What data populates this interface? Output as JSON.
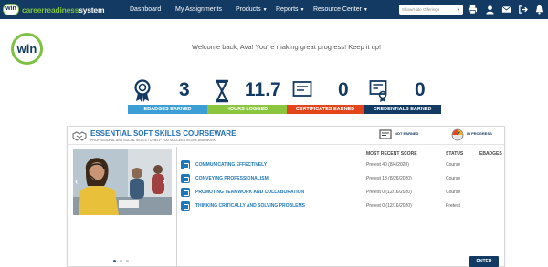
{
  "header": {
    "brand_prefix": "careerreadiness",
    "brand_suffix": "system",
    "badge_text": "win",
    "nav": [
      {
        "label": "Dashboard",
        "has_caret": false
      },
      {
        "label": "My Assignments",
        "has_caret": false
      },
      {
        "label": "Products",
        "has_caret": true
      },
      {
        "label": "Reports",
        "has_caret": true
      },
      {
        "label": "Resource Center",
        "has_caret": true
      }
    ],
    "offering_placeholder": "Show/Hide Offerings",
    "icons": [
      "print-icon",
      "user-icon",
      "mail-icon",
      "logout-icon",
      "bell-icon"
    ],
    "colors": {
      "bar": "#123a63",
      "accent": "#7ec142"
    }
  },
  "welcome": {
    "logo_text": "win",
    "message": "Welcome back, Ava! You're making great progress! Keep it up!"
  },
  "stats": [
    {
      "icon": "badge-ribbon-icon",
      "value": "3",
      "label": "EBADGES EARNED",
      "color": "#3b9fd6"
    },
    {
      "icon": "hourglass-icon",
      "value": "11.7",
      "label": "HOURS LOGGED",
      "color": "#8cc63f"
    },
    {
      "icon": "certificate-icon",
      "value": "0",
      "label": "CERTIFICATES EARNED",
      "color": "#e4461c"
    },
    {
      "icon": "credential-icon",
      "value": "0",
      "label": "CREDENTIALS EARNED",
      "color": "#123a63"
    }
  ],
  "courseware": {
    "title": "ESSENTIAL SOFT SKILLS COURSEWARE",
    "subtitle": "PROFESSIONAL AND SOCIAL SKILLS TO HELP YOU SUCCEED IN LIFE AND WORK",
    "legend_not_earned": "NOT EARNED",
    "legend_in_progress": "IN PROGRESS",
    "columns": {
      "score": "MOST RECENT SCORE",
      "status": "STATUS",
      "ebadges": "EBADGES"
    },
    "modules": [
      {
        "title": "COMMUNICATING EFFECTIVELY",
        "score": "Pretest 40 (8/4/2020)",
        "status": "Course"
      },
      {
        "title": "CONVEYING PROFESSIONALISM",
        "score": "Pretest 18 (8/26/2020)",
        "status": "Course"
      },
      {
        "title": "PROMOTING TEAMWORK AND COLLABORATION",
        "score": "Pretest 0 (12/16/2020)",
        "status": "Course"
      },
      {
        "title": "THINKING CRITICALLY AND SOLVING PROBLEMS",
        "score": "Pretest 0 (12/16/2020)",
        "status": "Pretest"
      }
    ],
    "carousel": {
      "prev": "‹",
      "next": "›",
      "dots": 3,
      "active_dot": 1
    },
    "enter_label": "ENTER"
  }
}
